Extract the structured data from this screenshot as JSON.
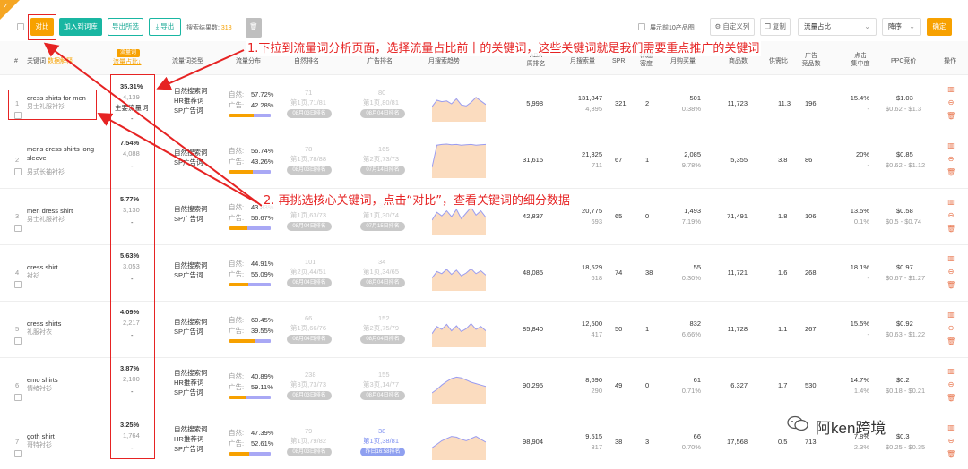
{
  "toolbar": {
    "compare_label": "对比",
    "add_to_library_label": "加入到词库",
    "export_selected_label": "导出所选",
    "export_icon": "download-icon",
    "export_label": "导出",
    "result_count_label": "搜索结果数:",
    "result_count_value": "318",
    "show_top10_label": "展示前10产品图",
    "custom_columns_label": "自定义列",
    "copy_label": "复制",
    "sort_field_value": "流量占比",
    "sort_order_value": "降序",
    "confirm_label": "确定",
    "trash_icon": "trash-icon"
  },
  "headers": {
    "index": "#",
    "keyword": "关键词",
    "keyword_translate": "数据解释",
    "traffic_badge": "流量词",
    "traffic_share": "流量占比↓",
    "type": "流量词类型",
    "distribution": "流量分布",
    "natural_rank": "自然排名",
    "ad_rank": "广告排名",
    "monthly_trend": "月搜索趋势",
    "aba_1": "ABA",
    "aba_2": "周排名",
    "monthly_search": "月搜索量",
    "spr": "SPR",
    "title_density_1": "标题",
    "title_density_2": "密度",
    "monthly_purchase": "月购买量",
    "product_count": "商品数",
    "supply_demand": "供需比",
    "ad_products_1": "广告",
    "ad_products_2": "竞品数",
    "click_conc_1": "点击",
    "click_conc_2": "集中度",
    "ppc": "PPC竞价",
    "ops": "操作"
  },
  "rows": [
    {
      "index": "1",
      "kw": "dress shirts for men",
      "kw_cn": "男士礼服衬衫",
      "share": "35.31%",
      "share_sub": "4,139",
      "share_tag": "主要流量词",
      "share_dash": "-",
      "types": [
        "自然搜索词",
        "HR推荐词",
        "SP广告词"
      ],
      "nat_label": "自然:",
      "nat_pct": "57.72%",
      "ad_label": "广告:",
      "ad_pct": "42.28%",
      "nat_frac": 0.5772,
      "nrank": "71",
      "nrank_sub": "第1页,71/81",
      "nrank_pill": "08月03日排名",
      "arank": "80",
      "arank_sub": "第1页,80/81",
      "arank_pill": "08月04日排名",
      "aba": "5,998",
      "search": "131,847",
      "search_sub": "4,395",
      "spr": "321",
      "density": "2",
      "purchase": "501",
      "purchase_sub": "0.38%",
      "products": "11,723",
      "sdr": "11.3",
      "adp": "196",
      "click": "15.4%",
      "click_sub": "-",
      "ppc": "$1.03",
      "ppc_sub": "$0.62 - $1.3",
      "trend": [
        42,
        60,
        56,
        58,
        50,
        64,
        47,
        44,
        54,
        68,
        58,
        48
      ]
    },
    {
      "index": "2",
      "kw": "mens dress shirts long sleeve",
      "kw_cn": "男式长袖衬衫",
      "share": "7.54%",
      "share_sub": "4,088",
      "share_tag": "",
      "share_dash": "-",
      "types": [
        "自然搜索词",
        "SP广告词"
      ],
      "nat_label": "自然:",
      "nat_pct": "56.74%",
      "ad_label": "广告:",
      "ad_pct": "43.26%",
      "nat_frac": 0.5674,
      "nrank": "78",
      "nrank_sub": "第1页,78/88",
      "nrank_pill": "08月03日排名",
      "arank": "165",
      "arank_sub": "第2页,73/73",
      "arank_pill": "07月14日排名",
      "aba": "31,615",
      "search": "21,325",
      "search_sub": "711",
      "spr": "67",
      "density": "1",
      "purchase": "2,085",
      "purchase_sub": "9.78%",
      "products": "5,355",
      "sdr": "3.8",
      "adp": "86",
      "click": "20%",
      "click_sub": "-",
      "ppc": "$0.85",
      "ppc_sub": "$0.62 - $1.12",
      "trend": [
        30,
        92,
        94,
        95,
        93,
        94,
        92,
        93,
        94,
        92,
        93,
        94
      ]
    },
    {
      "index": "3",
      "kw": "men dress shirt",
      "kw_cn": "男士礼服衬衫",
      "share": "5.77%",
      "share_sub": "3,130",
      "share_tag": "",
      "share_dash": "-",
      "types": [
        "自然搜索词",
        "SP广告词"
      ],
      "nat_label": "自然:",
      "nat_pct": "43.33%",
      "ad_label": "广告:",
      "ad_pct": "56.67%",
      "nat_frac": 0.4333,
      "nrank": "63",
      "nrank_sub": "第1页,63/73",
      "nrank_pill": "08月04日排名",
      "arank": "30",
      "arank_sub": "第1页,30/74",
      "arank_pill": "07月15日排名",
      "aba": "42,837",
      "search": "20,775",
      "search_sub": "693",
      "spr": "65",
      "density": "0",
      "purchase": "1,493",
      "purchase_sub": "7.19%",
      "products": "71,491",
      "sdr": "1.8",
      "adp": "106",
      "click": "13.5%",
      "click_sub": "0.1%",
      "ppc": "$0.58",
      "ppc_sub": "$0.5 - $0.74",
      "trend": [
        40,
        62,
        52,
        66,
        50,
        70,
        44,
        60,
        76,
        54,
        66,
        48
      ]
    },
    {
      "index": "4",
      "kw": "dress shirt",
      "kw_cn": "衬衫",
      "share": "5.63%",
      "share_sub": "3,053",
      "share_tag": "",
      "share_dash": "-",
      "types": [
        "自然搜索词",
        "SP广告词"
      ],
      "nat_label": "自然:",
      "nat_pct": "44.91%",
      "ad_label": "广告:",
      "ad_pct": "55.09%",
      "nat_frac": 0.4491,
      "nrank": "101",
      "nrank_sub": "第2页,44/51",
      "nrank_pill": "08月04日排名",
      "arank": "34",
      "arank_sub": "第1页,34/65",
      "arank_pill": "08月04日排名",
      "aba": "48,085",
      "search": "18,529",
      "search_sub": "618",
      "spr": "74",
      "density": "38",
      "purchase": "55",
      "purchase_sub": "0.30%",
      "products": "11,721",
      "sdr": "1.6",
      "adp": "268",
      "click": "18.1%",
      "click_sub": "-",
      "ppc": "$0.97",
      "ppc_sub": "$0.67 - $1.27",
      "trend": [
        36,
        54,
        48,
        60,
        46,
        58,
        42,
        50,
        62,
        48,
        56,
        44
      ]
    },
    {
      "index": "5",
      "kw": "dress shirts",
      "kw_cn": "礼服衬衣",
      "share": "4.09%",
      "share_sub": "2,217",
      "share_tag": "",
      "share_dash": "-",
      "types": [
        "自然搜索词",
        "SP广告词"
      ],
      "nat_label": "自然:",
      "nat_pct": "60.45%",
      "ad_label": "广告:",
      "ad_pct": "39.55%",
      "nat_frac": 0.6045,
      "nrank": "66",
      "nrank_sub": "第1页,66/76",
      "nrank_pill": "08月04日排名",
      "arank": "152",
      "arank_sub": "第2页,75/79",
      "arank_pill": "08月04日排名",
      "aba": "85,840",
      "search": "12,500",
      "search_sub": "417",
      "spr": "50",
      "density": "1",
      "purchase": "832",
      "purchase_sub": "6.66%",
      "products": "11,728",
      "sdr": "1.1",
      "adp": "267",
      "click": "15.5%",
      "click_sub": "-",
      "ppc": "$0.92",
      "ppc_sub": "$0.63 - $1.22",
      "trend": [
        38,
        58,
        50,
        64,
        46,
        60,
        44,
        52,
        66,
        50,
        58,
        46
      ]
    },
    {
      "index": "6",
      "kw": "emo shirts",
      "kw_cn": "情绪衬衫",
      "share": "3.87%",
      "share_sub": "2,100",
      "share_tag": "",
      "share_dash": "-",
      "types": [
        "自然搜索词",
        "HR推荐词",
        "SP广告词"
      ],
      "nat_label": "自然:",
      "nat_pct": "40.89%",
      "ad_label": "广告:",
      "ad_pct": "59.11%",
      "nat_frac": 0.4089,
      "nrank": "238",
      "nrank_sub": "第3页,73/73",
      "nrank_pill": "08月03日排名",
      "arank": "155",
      "arank_sub": "第3页,14/77",
      "arank_pill": "08月04日排名",
      "aba": "90,295",
      "search": "8,690",
      "search_sub": "290",
      "spr": "49",
      "density": "0",
      "purchase": "61",
      "purchase_sub": "0.71%",
      "products": "6,327",
      "sdr": "1.7",
      "adp": "530",
      "click": "14.7%",
      "click_sub": "1.4%",
      "ppc": "$0.2",
      "ppc_sub": "$0.18 - $0.21",
      "trend": [
        30,
        40,
        52,
        62,
        70,
        74,
        72,
        66,
        60,
        56,
        52,
        48
      ]
    },
    {
      "index": "7",
      "kw": "goth shirt",
      "kw_cn": "哥特衬衫",
      "share": "3.25%",
      "share_sub": "1,764",
      "share_tag": "",
      "share_dash": "-",
      "types": [
        "自然搜索词",
        "HR推荐词",
        "SP广告词"
      ],
      "nat_label": "自然:",
      "nat_pct": "47.39%",
      "ad_label": "广告:",
      "ad_pct": "52.61%",
      "nat_frac": 0.4739,
      "nrank": "79",
      "nrank_sub": "第1页,79/82",
      "nrank_pill": "08月03日排名",
      "arank": "38",
      "arank_sub": "第1页,38/81",
      "arank_pill": "昨日16:58排名",
      "arank_blue": true,
      "aba": "98,904",
      "search": "9,515",
      "search_sub": "317",
      "spr": "38",
      "density": "3",
      "purchase": "66",
      "purchase_sub": "0.70%",
      "products": "17,568",
      "sdr": "0.5",
      "adp": "713",
      "click": "7.8%",
      "click_sub": "2.3%",
      "ppc": "$0.3",
      "ppc_sub": "$0.25 - $0.35",
      "trend": [
        34,
        44,
        54,
        60,
        66,
        64,
        58,
        54,
        60,
        66,
        58,
        50
      ]
    }
  ],
  "annotations": {
    "step1": "1.下拉到流量词分析页面，选择流量占比前十的关键词，这些关键词就是我们需要重点推广的关键词",
    "step2": "2. 再挑选核心关键词，点击“对比”，查看关键词的细分数据"
  },
  "watermark": {
    "icon": "wechat-icon",
    "text": "阿ken跨境"
  },
  "colors": {
    "accent": "#f7a100",
    "teal": "#19b6a2",
    "annotation": "#e62323",
    "ad_bar": "#a9a8f5",
    "trend_line": "#9a9cf0",
    "trend_fill": "#fbdcbf"
  }
}
